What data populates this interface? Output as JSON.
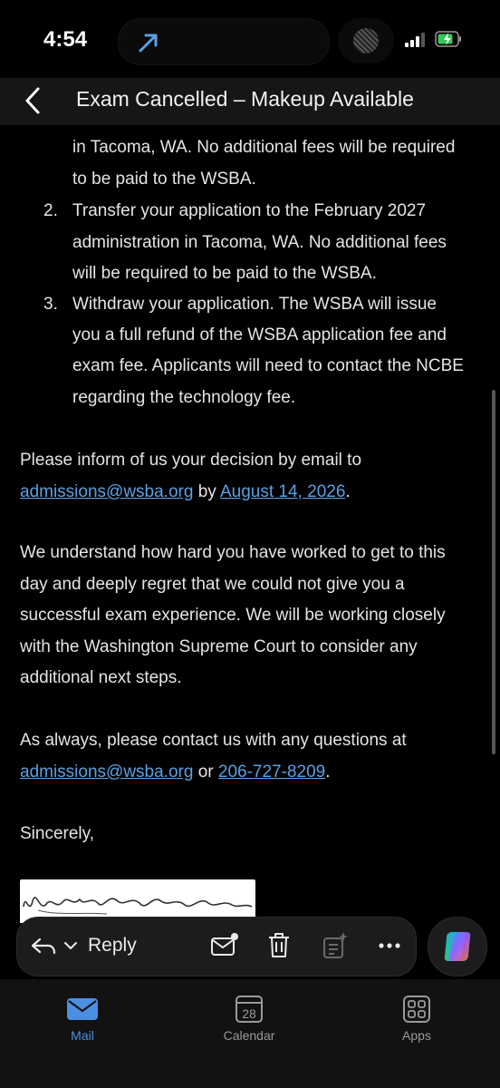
{
  "status_bar": {
    "time": "4:54"
  },
  "header": {
    "title": "Exam Cancelled – Makeup Available"
  },
  "email": {
    "option1_tail": [
      "in Tacoma, WA.  No additional fees will be required",
      "to be paid to the WSBA."
    ],
    "option2_num": "2.",
    "option2_lines": [
      "Transfer your application to the February 2027",
      "administration in Tacoma, WA.  No additional fees",
      "will be required to be paid to the WSBA."
    ],
    "option3_num": "3.",
    "option3_lines": [
      "Withdraw your application.  The WSBA will issue",
      "you a full refund of the WSBA application fee and",
      "exam fee.  Applicants will need to contact the NCBE",
      "regarding the technology fee."
    ],
    "inform_line1": "Please inform of us your decision by email to",
    "inform_email": "admissions@wsba.org",
    "inform_by": " by ",
    "inform_date": "August 14, 2026",
    "inform_end": ".",
    "regret_lines": [
      "We understand how hard you have worked to get to this",
      "day and deeply regret that we could not give you a",
      "successful exam experience. We will be working closely",
      "with the Washington Supreme Court to consider any",
      "additional next steps."
    ],
    "contact_line1": "As always, please contact us with any questions at",
    "contact_email": "admissions@wsba.org",
    "contact_or": " or ",
    "contact_phone": "206-727-8209",
    "contact_end": ".",
    "closing": "Sincerely,"
  },
  "toolbar": {
    "reply_label": "Reply"
  },
  "tabs": [
    {
      "label": "Mail",
      "icon": "mail-icon",
      "active": true
    },
    {
      "label": "Calendar",
      "icon": "calendar-icon",
      "calendar_day": "28",
      "active": false
    },
    {
      "label": "Apps",
      "icon": "apps-icon",
      "active": false
    }
  ],
  "colors": {
    "link": "#5aa1e3",
    "accent": "#4a90e2",
    "background": "#000000"
  }
}
